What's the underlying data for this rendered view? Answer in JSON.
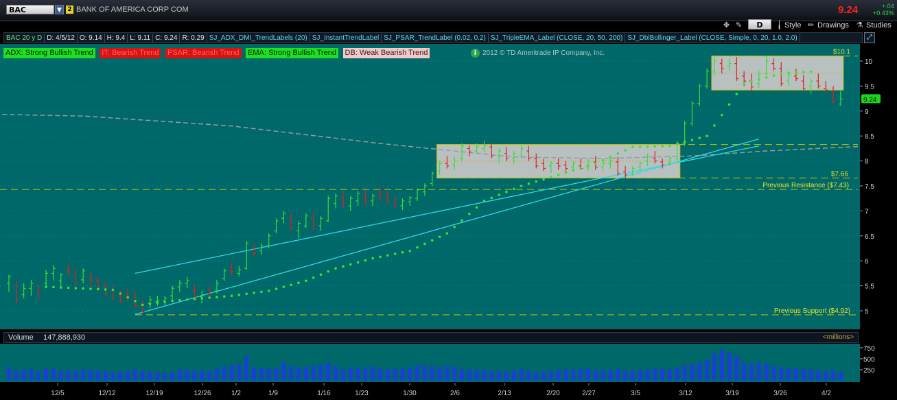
{
  "header": {
    "symbol": "BAC",
    "link_badge": "2",
    "company": "BANK OF AMERICA CORP COM",
    "last_price": "9.24",
    "change": "+.04",
    "change_pct": "+0.43%"
  },
  "toolbar": {
    "d_button": "D",
    "style_label": "Style",
    "drawings_label": "Drawings",
    "studies_label": "Studies"
  },
  "study_line": {
    "items": [
      "BAC 20 y D",
      "D: 4/5/12",
      "O: 9.14",
      "H: 9.4",
      "L: 9.11",
      "C: 9.24",
      "R: 0.29",
      "SJ_ADX_DMI_TrendLabels (20)",
      "SJ_InstantTrendLabel",
      "SJ_PSAR_TrendLabel (0.02, 0.2)",
      "SJ_TripleEMA_Label (CLOSE, 20, 50, 200)",
      "SJ_DblBollinger_Label (CLOSE, Simple, 0, 20, 1.0, 2.0)"
    ]
  },
  "labels": [
    {
      "text": "ADX:  Strong Bullish Trend",
      "bg": "#1fe01f",
      "fg": "#06220a"
    },
    {
      "text": "IT: Bearish Trend",
      "bg": "#d91212",
      "fg": "#ff6060"
    },
    {
      "text": "PSAR: Bearish Trend",
      "bg": "#d91212",
      "fg": "#ff6060"
    },
    {
      "text": "EMA: Strong Bullish Trend",
      "bg": "#1fe01f",
      "fg": "#06220a"
    },
    {
      "text": "DB: Weak Bearish Trend",
      "bg": "#f2c8c8",
      "fg": "#3a2020"
    }
  ],
  "copyright": "2012 © TD Ameritrade IP Company, Inc.",
  "volume": {
    "label": "Volume",
    "value": "147,888,930",
    "unit": "<millions>"
  },
  "colors": {
    "bg": "#006666",
    "up": "#35e035",
    "down": "#e02020",
    "psar": "#2fe82f",
    "trend": "#2fd8e8",
    "level": "#c8c300",
    "ma": "#9a9aa0",
    "volume": "#1a3fd9"
  },
  "chart_data": {
    "type": "ohlc",
    "y_ticks": [
      "10",
      "9.5",
      "9",
      "8.5",
      "8",
      "7.5",
      "7",
      "6.5",
      "6",
      "5.5",
      "5"
    ],
    "ylim": [
      4.8,
      10.3
    ],
    "x_ticks": [
      "12/5",
      "12/12",
      "12/19",
      "12/26",
      "1/2",
      "1/9",
      "1/16",
      "1/23",
      "1/30",
      "2/6",
      "2/13",
      "2/20",
      "2/27",
      "3/5",
      "3/12",
      "3/19",
      "3/26",
      "4/2"
    ],
    "bars": [
      [
        5.55,
        5.72,
        5.38,
        5.68
      ],
      [
        5.5,
        5.6,
        5.15,
        5.22
      ],
      [
        5.32,
        5.55,
        5.25,
        5.45
      ],
      [
        5.45,
        5.62,
        5.3,
        5.55
      ],
      [
        5.42,
        5.52,
        5.25,
        5.3
      ],
      [
        5.55,
        5.82,
        5.5,
        5.75
      ],
      [
        5.75,
        5.92,
        5.6,
        5.85
      ],
      [
        5.6,
        5.75,
        5.45,
        5.72
      ],
      [
        5.8,
        5.95,
        5.7,
        5.78
      ],
      [
        5.72,
        5.85,
        5.5,
        5.55
      ],
      [
        5.62,
        5.85,
        5.55,
        5.8
      ],
      [
        5.65,
        5.78,
        5.5,
        5.62
      ],
      [
        5.6,
        5.68,
        5.4,
        5.45
      ],
      [
        5.48,
        5.58,
        5.3,
        5.35
      ],
      [
        5.4,
        5.52,
        5.2,
        5.25
      ],
      [
        5.3,
        5.42,
        5.15,
        5.2
      ],
      [
        5.32,
        5.45,
        5.18,
        5.25
      ],
      [
        5.3,
        5.38,
        5.05,
        5.1
      ],
      [
        5.1,
        5.2,
        4.95,
        4.98
      ],
      [
        5.15,
        5.3,
        5.05,
        5.22
      ],
      [
        5.18,
        5.3,
        5.1,
        5.2
      ],
      [
        5.2,
        5.3,
        5.12,
        5.25
      ],
      [
        5.3,
        5.5,
        5.22,
        5.45
      ],
      [
        5.48,
        5.62,
        5.38,
        5.55
      ],
      [
        5.55,
        5.68,
        5.45,
        5.6
      ],
      [
        5.4,
        5.52,
        5.22,
        5.28
      ],
      [
        5.28,
        5.4,
        5.15,
        5.32
      ],
      [
        5.35,
        5.48,
        5.25,
        5.3
      ],
      [
        5.4,
        5.62,
        5.35,
        5.55
      ],
      [
        5.65,
        5.85,
        5.6,
        5.8
      ],
      [
        5.8,
        5.95,
        5.7,
        5.78
      ],
      [
        5.75,
        5.9,
        5.7,
        5.82
      ],
      [
        5.85,
        6.4,
        5.82,
        6.35
      ],
      [
        6.25,
        6.35,
        6.1,
        6.15
      ],
      [
        6.2,
        6.35,
        6.12,
        6.3
      ],
      [
        6.3,
        6.55,
        6.25,
        6.5
      ],
      [
        6.6,
        6.85,
        6.55,
        6.8
      ],
      [
        6.85,
        7.0,
        6.75,
        6.95
      ],
      [
        6.85,
        6.95,
        6.6,
        6.65
      ],
      [
        6.6,
        6.8,
        6.45,
        6.75
      ],
      [
        6.7,
        6.95,
        6.65,
        6.9
      ],
      [
        6.85,
        6.95,
        6.6,
        6.65
      ],
      [
        6.7,
        6.9,
        6.6,
        6.85
      ],
      [
        6.8,
        7.3,
        6.78,
        7.25
      ],
      [
        7.15,
        7.35,
        7.05,
        7.3
      ],
      [
        7.25,
        7.4,
        7.05,
        7.15
      ],
      [
        7.1,
        7.3,
        7.0,
        7.25
      ],
      [
        7.2,
        7.4,
        7.1,
        7.35
      ],
      [
        7.3,
        7.42,
        7.12,
        7.2
      ],
      [
        7.2,
        7.35,
        7.1,
        7.3
      ],
      [
        7.35,
        7.48,
        7.22,
        7.28
      ],
      [
        7.3,
        7.4,
        7.15,
        7.2
      ],
      [
        7.18,
        7.3,
        7.05,
        7.12
      ],
      [
        7.1,
        7.25,
        7.02,
        7.2
      ],
      [
        7.18,
        7.3,
        7.1,
        7.26
      ],
      [
        7.25,
        7.45,
        7.2,
        7.42
      ],
      [
        7.38,
        7.55,
        7.3,
        7.5
      ],
      [
        7.55,
        7.8,
        7.5,
        7.75
      ],
      [
        7.8,
        8.0,
        7.72,
        7.95
      ],
      [
        7.95,
        8.1,
        7.85,
        7.9
      ],
      [
        7.92,
        8.08,
        7.82,
        8.0
      ],
      [
        8.05,
        8.35,
        8.0,
        8.3
      ],
      [
        8.25,
        8.32,
        8.1,
        8.18
      ],
      [
        8.2,
        8.35,
        8.15,
        8.28
      ],
      [
        8.25,
        8.4,
        8.18,
        8.3
      ],
      [
        8.28,
        8.35,
        8.05,
        8.1
      ],
      [
        8.1,
        8.25,
        7.95,
        8.2
      ],
      [
        8.15,
        8.28,
        8.0,
        8.05
      ],
      [
        8.05,
        8.2,
        7.95,
        8.15
      ],
      [
        8.1,
        8.3,
        8.05,
        8.25
      ],
      [
        8.2,
        8.3,
        8.0,
        8.05
      ],
      [
        8.05,
        8.15,
        7.85,
        7.9
      ],
      [
        7.95,
        8.05,
        7.8,
        7.85
      ],
      [
        7.9,
        8.0,
        7.75,
        7.95
      ],
      [
        7.95,
        8.05,
        7.82,
        7.9
      ],
      [
        7.92,
        8.0,
        7.75,
        7.85
      ],
      [
        7.88,
        8.0,
        7.78,
        7.95
      ],
      [
        7.9,
        8.05,
        7.82,
        7.85
      ],
      [
        7.88,
        8.05,
        7.8,
        8.0
      ],
      [
        7.98,
        8.1,
        7.82,
        7.88
      ],
      [
        7.88,
        8.02,
        7.8,
        7.95
      ],
      [
        7.95,
        8.1,
        7.85,
        8.0
      ],
      [
        7.98,
        8.08,
        7.7,
        7.75
      ],
      [
        7.78,
        7.9,
        7.65,
        7.72
      ],
      [
        7.75,
        7.9,
        7.7,
        7.85
      ],
      [
        7.88,
        8.0,
        7.8,
        7.95
      ],
      [
        8.0,
        8.15,
        7.9,
        8.1
      ],
      [
        8.05,
        8.2,
        7.95,
        8.0
      ],
      [
        7.98,
        8.05,
        7.85,
        7.92
      ],
      [
        7.95,
        8.1,
        7.9,
        8.05
      ],
      [
        8.05,
        8.4,
        8.0,
        8.35
      ],
      [
        8.35,
        8.8,
        8.3,
        8.75
      ],
      [
        8.75,
        9.2,
        8.7,
        9.15
      ],
      [
        9.15,
        9.55,
        9.1,
        9.5
      ],
      [
        9.5,
        9.85,
        9.45,
        9.8
      ],
      [
        9.8,
        10.1,
        9.7,
        10.0
      ],
      [
        9.95,
        10.05,
        9.75,
        9.85
      ],
      [
        9.9,
        10.05,
        9.8,
        9.95
      ],
      [
        9.95,
        10.08,
        9.6,
        9.65
      ],
      [
        9.7,
        9.8,
        9.5,
        9.6
      ],
      [
        9.6,
        9.75,
        9.4,
        9.48
      ],
      [
        9.55,
        9.8,
        9.45,
        9.75
      ],
      [
        9.75,
        10.1,
        9.7,
        10.0
      ],
      [
        9.95,
        10.05,
        9.8,
        9.85
      ],
      [
        9.85,
        9.98,
        9.5,
        9.55
      ],
      [
        9.6,
        9.8,
        9.5,
        9.72
      ],
      [
        9.7,
        9.85,
        9.6,
        9.65
      ],
      [
        9.6,
        9.72,
        9.4,
        9.45
      ],
      [
        9.5,
        9.65,
        9.35,
        9.6
      ],
      [
        9.6,
        9.75,
        9.45,
        9.5
      ],
      [
        9.45,
        9.6,
        9.35,
        9.42
      ],
      [
        9.4,
        9.5,
        9.15,
        9.2
      ],
      [
        9.14,
        9.4,
        9.11,
        9.24
      ]
    ],
    "psar": [
      [
        5,
        5.48
      ],
      [
        14,
        5.42
      ],
      [
        18,
        5.12
      ],
      [
        22,
        5.2
      ],
      [
        30,
        5.3
      ],
      [
        35,
        5.4
      ],
      [
        40,
        5.6
      ],
      [
        44,
        5.85
      ],
      [
        49,
        6.05
      ],
      [
        54,
        6.2
      ],
      [
        59,
        6.55
      ],
      [
        64,
        7.2
      ],
      [
        69,
        7.5
      ],
      [
        74,
        7.72
      ],
      [
        79,
        7.95
      ],
      [
        84,
        8.28
      ],
      [
        89,
        8.3
      ],
      [
        94,
        8.5
      ],
      [
        99,
        9.55
      ],
      [
        104,
        9.75
      ],
      [
        109,
        9.8
      ]
    ],
    "ma200": [
      [
        -8,
        8.95
      ],
      [
        10,
        8.9
      ],
      [
        30,
        8.7
      ],
      [
        50,
        8.35
      ],
      [
        68,
        8.08
      ],
      [
        80,
        8.05
      ],
      [
        92,
        8.1
      ],
      [
        102,
        8.2
      ],
      [
        116,
        8.3
      ]
    ],
    "upper_trend": [
      [
        17,
        5.75
      ],
      [
        101,
        8.3
      ]
    ],
    "lower_trend": [
      [
        17,
        4.93
      ],
      [
        101,
        8.44
      ]
    ],
    "resistance": 7.43,
    "support": 4.92,
    "level_766": 7.66,
    "level_101": 10.1,
    "box1": {
      "x1": 58,
      "x2": 90,
      "y1": 7.66,
      "y2": 8.33
    },
    "box2": {
      "x1": 95,
      "x2": 112,
      "y1": 9.42,
      "y2": 10.1
    },
    "annotations": {
      "level_1": "$10.1",
      "level_2": "$7.66",
      "resistance": "Previous Resistance ($7.43)",
      "support": "Previous Support ($4.92)",
      "price_tag": "9.24"
    },
    "volume_ticks": [
      "750",
      "500",
      "250"
    ],
    "volume_ylim": [
      0,
      780
    ],
    "volume": [
      310,
      230,
      260,
      270,
      220,
      300,
      280,
      250,
      240,
      230,
      260,
      250,
      230,
      220,
      200,
      210,
      240,
      260,
      230,
      210,
      190,
      170,
      200,
      260,
      250,
      230,
      230,
      240,
      280,
      320,
      350,
      380,
      560,
      300,
      300,
      290,
      280,
      420,
      330,
      300,
      320,
      340,
      370,
      420,
      330,
      260,
      300,
      310,
      290,
      330,
      270,
      260,
      280,
      290,
      300,
      350,
      340,
      330,
      310,
      340,
      320,
      260,
      260,
      250,
      250,
      230,
      230,
      210,
      250,
      270,
      240,
      200,
      220,
      230,
      250,
      260,
      260,
      270,
      280,
      250,
      240,
      250,
      270,
      230,
      240,
      250,
      260,
      280,
      280,
      260,
      300,
      350,
      380,
      420,
      480,
      620,
      700,
      650,
      560,
      420,
      380,
      430,
      400,
      330,
      310,
      300,
      280,
      270,
      260,
      240,
      220,
      250,
      210
    ]
  }
}
